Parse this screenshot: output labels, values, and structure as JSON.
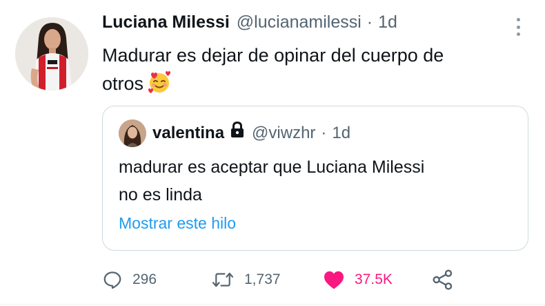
{
  "author": {
    "display_name": "Luciana Milessi",
    "handle": "@lucianamilessi",
    "separator": "·",
    "time": "1d"
  },
  "tweet": {
    "text_line1": "Madurar es dejar de opinar del cuerpo de",
    "text_line2": "otros",
    "emoji": "smiling-face-with-hearts-icon"
  },
  "quote": {
    "display_name": "valentina",
    "protected_icon": "lock-icon",
    "handle": "@viwzhr",
    "separator": "·",
    "time": "1d",
    "text_line1": "madurar es aceptar que Luciana Milessi",
    "text_line2": "no es linda",
    "thread_link": "Mostrar este hilo"
  },
  "actions": {
    "reply_count": "296",
    "retweet_count": "1,737",
    "like_count": "37.5K"
  },
  "colors": {
    "text": "#0f1419",
    "secondary": "#536471",
    "link": "#1d9bf0",
    "like": "#f91880",
    "border": "#cfd9de"
  }
}
